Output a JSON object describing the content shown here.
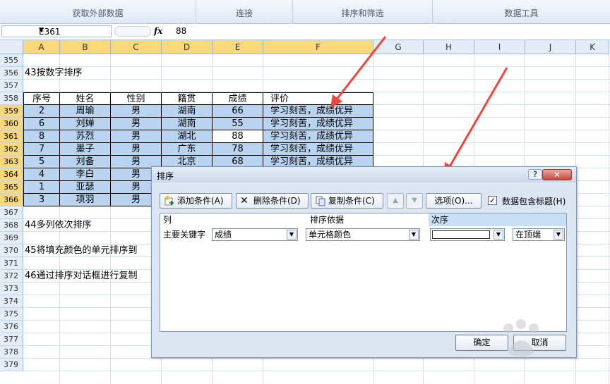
{
  "ribbon": {
    "groups": [
      "获取外部数据",
      "连接",
      "排序和筛选",
      "数据工具"
    ]
  },
  "formula_bar": {
    "name_box": "E361",
    "fx": "fx",
    "value": "88"
  },
  "columns": [
    "A",
    "B",
    "C",
    "D",
    "E",
    "F",
    "G",
    "H",
    "I",
    "J",
    "K"
  ],
  "rows": [
    "355",
    "356",
    "357",
    "358",
    "359",
    "360",
    "361",
    "362",
    "363",
    "364",
    "365",
    "366",
    "367",
    "368",
    "369",
    "370",
    "371",
    "372",
    "373",
    "374",
    "375",
    "376",
    "377",
    "378",
    "379"
  ],
  "sheet": {
    "heading_356": "43按数字排序",
    "heading_368": "44多列依次排序",
    "heading_370": "45将填充颜色的单元排序到",
    "heading_372": "46通过排序对话框进行复制",
    "table_header": [
      "序号",
      "姓名",
      "性别",
      "籍贯",
      "成绩",
      "评价"
    ],
    "table_rows": [
      [
        "2",
        "周瑜",
        "男",
        "湖南",
        "66",
        "学习刻苦，成绩优异"
      ],
      [
        "6",
        "刘婵",
        "男",
        "湖南",
        "55",
        "学习刻苦，成绩优异"
      ],
      [
        "8",
        "苏烈",
        "男",
        "湖北",
        "88",
        "学习刻苦，成绩优异"
      ],
      [
        "7",
        "墨子",
        "男",
        "广东",
        "78",
        "学习刻苦，成绩优异"
      ],
      [
        "5",
        "刘备",
        "男",
        "北京",
        "68",
        "学习刻苦，成绩优异"
      ],
      [
        "4",
        "李白",
        "男",
        "",
        "",
        ""
      ],
      [
        "1",
        "亚瑟",
        "男",
        "",
        "",
        ""
      ],
      [
        "3",
        "项羽",
        "男",
        "",
        "",
        ""
      ]
    ]
  },
  "dialog": {
    "title": "排序",
    "help": "?",
    "close": "✕",
    "add_level": "添加条件(A)",
    "delete_level": "删除条件(D)",
    "copy_level": "复制条件(C)",
    "move_up": "▲",
    "move_down": "▼",
    "options": "选项(O)...",
    "has_headers_label": "数据包含标题(H)",
    "has_headers_checked": "✓",
    "col_header_column": "列",
    "col_header_sort_on": "排序依据",
    "col_header_order": "次序",
    "row_label": "主要关键字",
    "column_value": "成绩",
    "sort_on_value": "单元格颜色",
    "position_value": "在顶端",
    "ok": "确定",
    "cancel": "取消"
  },
  "colors": {
    "selection": "#b8d4f0",
    "header_highlight": "#f9d87a",
    "arrow": "#f0453a",
    "close_button": "#c9453a"
  }
}
